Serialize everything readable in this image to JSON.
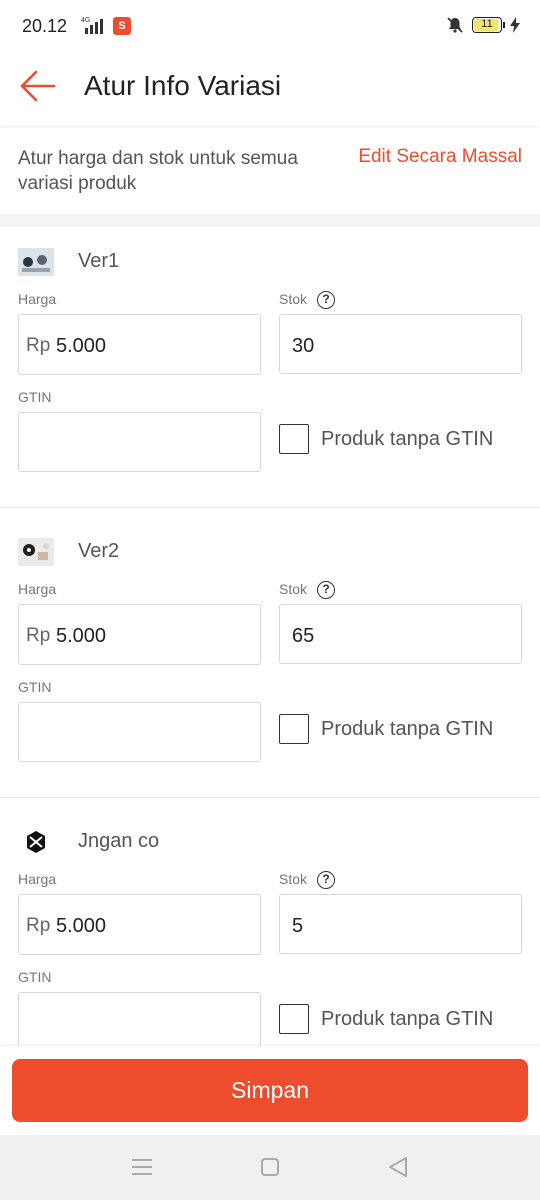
{
  "status": {
    "time": "20.12",
    "network": "4G",
    "shop_badge": "S",
    "battery": "11"
  },
  "header": {
    "title": "Atur Info Variasi"
  },
  "intro": {
    "text": "Atur harga dan stok untuk semua variasi produk",
    "mass_edit_label": "Edit Secara Massal"
  },
  "labels": {
    "price": "Harga",
    "stock": "Stok",
    "gtin": "GTIN",
    "currency": "Rp",
    "no_gtin": "Produk tanpa GTIN"
  },
  "variants": [
    {
      "name": "Ver1",
      "price": "5.000",
      "stock": "30",
      "gtin": "",
      "no_gtin_checked": false
    },
    {
      "name": "Ver2",
      "price": "5.000",
      "stock": "65",
      "gtin": "",
      "no_gtin_checked": false
    },
    {
      "name": "Jngan co",
      "price": "5.000",
      "stock": "5",
      "gtin": "",
      "no_gtin_checked": false
    }
  ],
  "footer": {
    "save_label": "Simpan"
  },
  "colors": {
    "accent": "#ee4d2d"
  },
  "icons": {
    "back": "arrow-left-icon",
    "help": "question-circle-icon",
    "nav": [
      "menu-icon",
      "home-square-icon",
      "back-triangle-icon"
    ]
  }
}
